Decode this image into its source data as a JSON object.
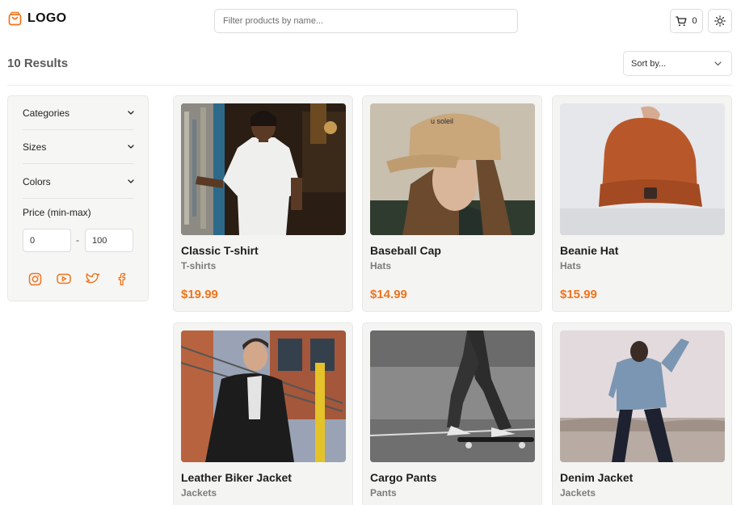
{
  "header": {
    "logo_text": "LOGO",
    "search_placeholder": "Filter products by name...",
    "cart_count": "0"
  },
  "results": {
    "count_label": "10 Results",
    "sort_label": "Sort by..."
  },
  "filters": {
    "items": [
      {
        "label": "Categories"
      },
      {
        "label": "Sizes"
      },
      {
        "label": "Colors"
      }
    ],
    "price_label": "Price (min-max)",
    "price_min": "0",
    "price_max": "100",
    "price_separator": "-",
    "socials": [
      "instagram-icon",
      "youtube-icon",
      "twitter-icon",
      "facebook-icon"
    ]
  },
  "products": [
    {
      "name": "Classic T-shirt",
      "category": "T-shirts",
      "price": "$19.99"
    },
    {
      "name": "Baseball Cap",
      "category": "Hats",
      "price": "$14.99"
    },
    {
      "name": "Beanie Hat",
      "category": "Hats",
      "price": "$15.99"
    },
    {
      "name": "Leather Biker Jacket",
      "category": "Jackets",
      "price": ""
    },
    {
      "name": "Cargo Pants",
      "category": "Pants",
      "price": ""
    },
    {
      "name": "Denim Jacket",
      "category": "Jackets",
      "price": ""
    }
  ],
  "colors": {
    "accent": "#f0741c",
    "card_bg": "#f4f4f2"
  }
}
